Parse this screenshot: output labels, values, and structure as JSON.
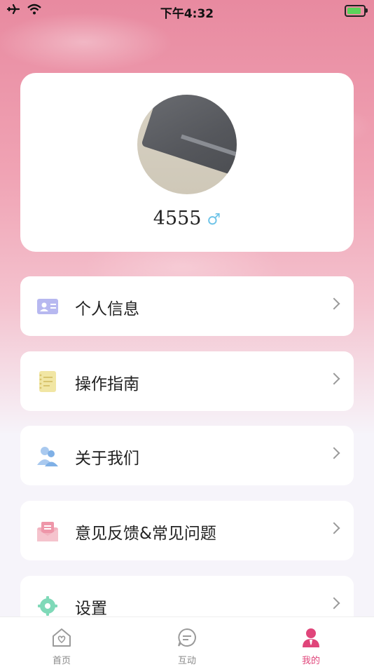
{
  "status_bar": {
    "time": "下午4:32",
    "battery_level": 0.85
  },
  "profile": {
    "name": "4555",
    "gender_symbol": "♂"
  },
  "menu": [
    {
      "label": "个人信息",
      "icon": "id-card-icon"
    },
    {
      "label": "操作指南",
      "icon": "notebook-icon"
    },
    {
      "label": "关于我们",
      "icon": "users-icon"
    },
    {
      "label": "意见反馈&常见问题",
      "icon": "envelope-icon"
    },
    {
      "label": "设置",
      "icon": "gear-icon"
    }
  ],
  "tabs": [
    {
      "label": "首页",
      "icon": "home-heart-icon"
    },
    {
      "label": "互动",
      "icon": "chat-bubble-icon"
    },
    {
      "label": "我的",
      "icon": "person-icon",
      "active": true
    }
  ],
  "colors": {
    "accent": "#e0457a",
    "gender": "#6fc4e8",
    "inactive": "#888888"
  }
}
